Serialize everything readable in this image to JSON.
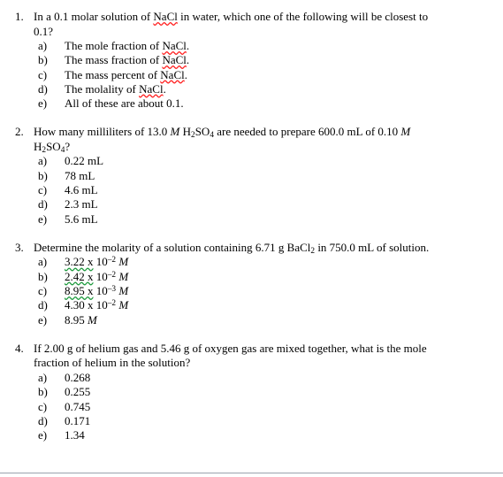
{
  "document": {
    "type": "chemistry-multiple-choice-quiz",
    "questions": [
      {
        "number": "1.",
        "stem_line1": "In a 0.1 molar solution of ",
        "stem_nacl": "NaCl",
        "stem_line1b": " in water, which one of the following will be closest to",
        "stem_line2": "0.1?",
        "options": [
          {
            "letter": "a)",
            "pre": "The mole fraction of ",
            "term": "NaCl",
            "post": "."
          },
          {
            "letter": "b)",
            "pre": "The mass fraction of ",
            "term": "NaCl",
            "post": "."
          },
          {
            "letter": "c)",
            "pre": "The mass percent of ",
            "term": "NaCl",
            "post": "."
          },
          {
            "letter": "d)",
            "pre": "The molality of ",
            "term": "NaCl",
            "post": "."
          },
          {
            "letter": "e)",
            "pre": "All of these are about 0.1.",
            "term": "",
            "post": ""
          }
        ]
      },
      {
        "number": "2.",
        "stem_a": "How many milliliters of 13.0 ",
        "molar_symbol": "M",
        "stem_b": " H",
        "sub_2": "2",
        "stem_c": "SO",
        "sub_4": "4",
        "stem_d": " are needed to prepare 600.0 mL of 0.10 ",
        "stem_e": "?",
        "options": [
          {
            "letter": "a)",
            "value": "0.22 mL"
          },
          {
            "letter": "b)",
            "value": "78 mL"
          },
          {
            "letter": "c)",
            "value": "4.6 mL"
          },
          {
            "letter": "d)",
            "value": "2.3 mL"
          },
          {
            "letter": "e)",
            "value": "5.6 mL"
          }
        ]
      },
      {
        "number": "3.",
        "stem_a": "Determine the molarity of a solution containing 6.71 g BaCl",
        "sub_2": "2",
        "stem_b": " in 750.0 mL of solution.",
        "options": [
          {
            "letter": "a)",
            "mantissa": "3.22 x",
            "base": " 10",
            "exponent": "–2",
            "unit": "M",
            "flagged": "green"
          },
          {
            "letter": "b)",
            "mantissa": "2.42 x",
            "base": " 10",
            "exponent": "–2",
            "unit": "M",
            "flagged": "green"
          },
          {
            "letter": "c)",
            "mantissa": "8.95 x",
            "base": " 10",
            "exponent": "–3",
            "unit": "M",
            "flagged": "green"
          },
          {
            "letter": "d)",
            "mantissa": "4.30 x",
            "base": " 10",
            "exponent": "–2",
            "unit": "M",
            "flagged": "none"
          },
          {
            "letter": "e)",
            "mantissa": "8.95",
            "base": "",
            "exponent": "",
            "unit": "M",
            "flagged": "none"
          }
        ]
      },
      {
        "number": "4.",
        "stem_line1": "If 2.00 g of helium gas and 5.46 g of oxygen gas are mixed together, what is the mole",
        "stem_line2": "fraction of helium in the solution?",
        "options": [
          {
            "letter": "a)",
            "value": "0.268"
          },
          {
            "letter": "b)",
            "value": "0.255"
          },
          {
            "letter": "c)",
            "value": "0.745"
          },
          {
            "letter": "d)",
            "value": "0.171"
          },
          {
            "letter": "e)",
            "value": "1.34"
          }
        ]
      }
    ]
  },
  "colors": {
    "text": "#000000",
    "background": "#ffffff",
    "spelling_underline": "#ff2020",
    "grammar_underline": "#1f9b3f",
    "footer_rule": "#9aa2ad"
  }
}
